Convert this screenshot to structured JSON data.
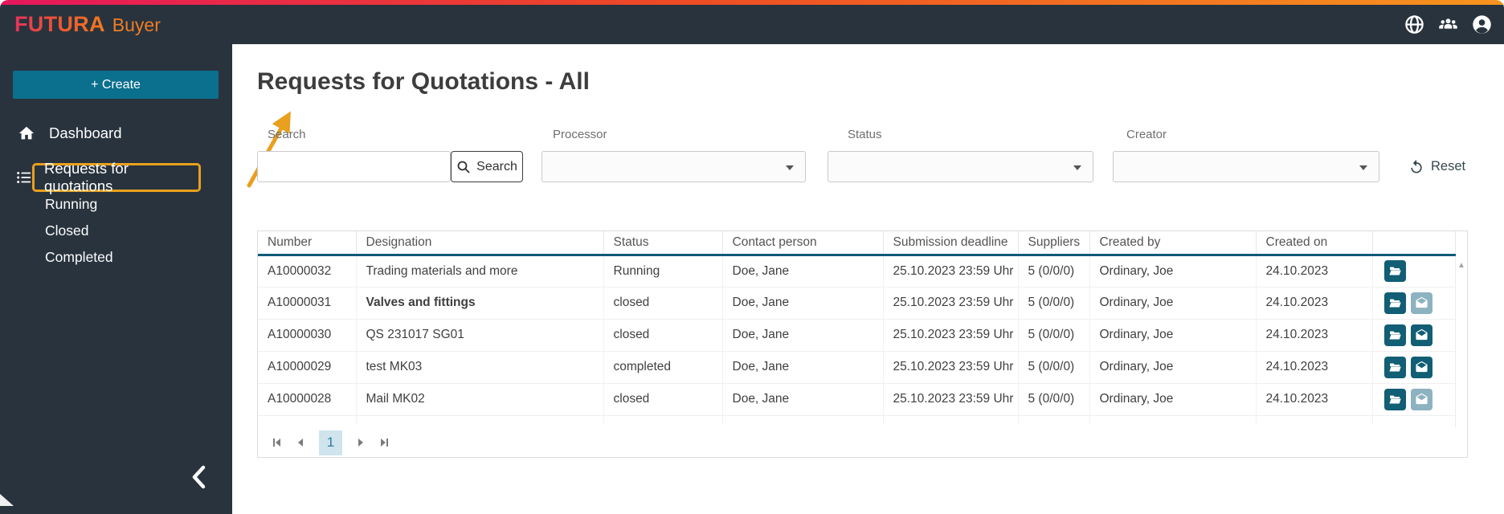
{
  "topbar": {
    "brand": "FUTURA",
    "brand_suffix": "Buyer",
    "icons": [
      "globe-icon",
      "team-icon",
      "account-icon"
    ]
  },
  "sidebar": {
    "create_label": "+ Create",
    "dashboard_label": "Dashboard",
    "rfq_label": "Requests for quotations",
    "subitems": [
      "Running",
      "Closed",
      "Completed"
    ],
    "collapse_icon": "chevron-left-icon"
  },
  "page": {
    "title": "Requests for Quotations - All"
  },
  "filters": {
    "search_label": "Search",
    "search_value": "",
    "search_button_label": "Search",
    "processor_label": "Processor",
    "processor_value": "",
    "status_label": "Status",
    "status_value": "",
    "creator_label": "Creator",
    "creator_value": "",
    "reset_label": "Reset"
  },
  "table": {
    "columns": [
      "Number",
      "Designation",
      "Status",
      "Contact person",
      "Submission deadline",
      "Suppliers",
      "Created by",
      "Created on",
      ""
    ],
    "fields": [
      "number",
      "designation",
      "status",
      "contact_person",
      "submission_deadline",
      "suppliers",
      "created_by",
      "created_on"
    ],
    "rows": [
      {
        "number": "A10000032",
        "designation": "Trading materials and more",
        "designation_bold": false,
        "status": "Running",
        "contact_person": "Doe, Jane",
        "submission_deadline": "25.10.2023 23:59 Uhr",
        "suppliers": "5 (0/0/0)",
        "created_by": "Ordinary, Joe",
        "created_on": "24.10.2023",
        "actions": [
          {
            "icon": "folder-open",
            "variant": "dark"
          }
        ]
      },
      {
        "number": "A10000031",
        "designation": "Valves and fittings",
        "designation_bold": true,
        "status": "closed",
        "contact_person": "Doe, Jane",
        "submission_deadline": "25.10.2023 23:59 Uhr",
        "suppliers": "5 (0/0/0)",
        "created_by": "Ordinary, Joe",
        "created_on": "24.10.2023",
        "actions": [
          {
            "icon": "folder-open",
            "variant": "dark"
          },
          {
            "icon": "mail-open",
            "variant": "light"
          }
        ]
      },
      {
        "number": "A10000030",
        "designation": "QS 231017 SG01",
        "designation_bold": false,
        "status": "closed",
        "contact_person": "Doe, Jane",
        "submission_deadline": "25.10.2023 23:59 Uhr",
        "suppliers": "5 (0/0/0)",
        "created_by": "Ordinary, Joe",
        "created_on": "24.10.2023",
        "actions": [
          {
            "icon": "folder-open",
            "variant": "dark"
          },
          {
            "icon": "mail-open",
            "variant": "dark"
          }
        ]
      },
      {
        "number": "A10000029",
        "designation": "test MK03",
        "designation_bold": false,
        "status": "completed",
        "contact_person": "Doe, Jane",
        "submission_deadline": "25.10.2023 23:59 Uhr",
        "suppliers": "5 (0/0/0)",
        "created_by": "Ordinary, Joe",
        "created_on": "24.10.2023",
        "actions": [
          {
            "icon": "folder-open",
            "variant": "dark"
          },
          {
            "icon": "mail-open",
            "variant": "dark"
          }
        ]
      },
      {
        "number": "A10000028",
        "designation": "Mail MK02",
        "designation_bold": false,
        "status": "closed",
        "contact_person": "Doe, Jane",
        "submission_deadline": "25.10.2023 23:59 Uhr",
        "suppliers": "5 (0/0/0)",
        "created_by": "Ordinary, Joe",
        "created_on": "24.10.2023",
        "actions": [
          {
            "icon": "folder-open",
            "variant": "dark"
          },
          {
            "icon": "mail-open",
            "variant": "light"
          }
        ]
      }
    ]
  },
  "pagination": {
    "current_page": "1",
    "icons": [
      "first-page-icon",
      "prev-page-icon",
      "next-page-icon",
      "last-page-icon"
    ]
  },
  "scrollbar": {
    "up_icon": "scroll-up-icon"
  },
  "colors": {
    "topbar_bg": "#28333d",
    "accent_teal": "#115e75",
    "create_button_teal": "#0b6f8e",
    "annotation_orange": "#e9a01e",
    "brand_gradient_start": "#e6175c",
    "brand_gradient_end": "#f7941e",
    "action_light_teal": "#8db2c0",
    "active_page_bg": "#cfe4ed"
  }
}
